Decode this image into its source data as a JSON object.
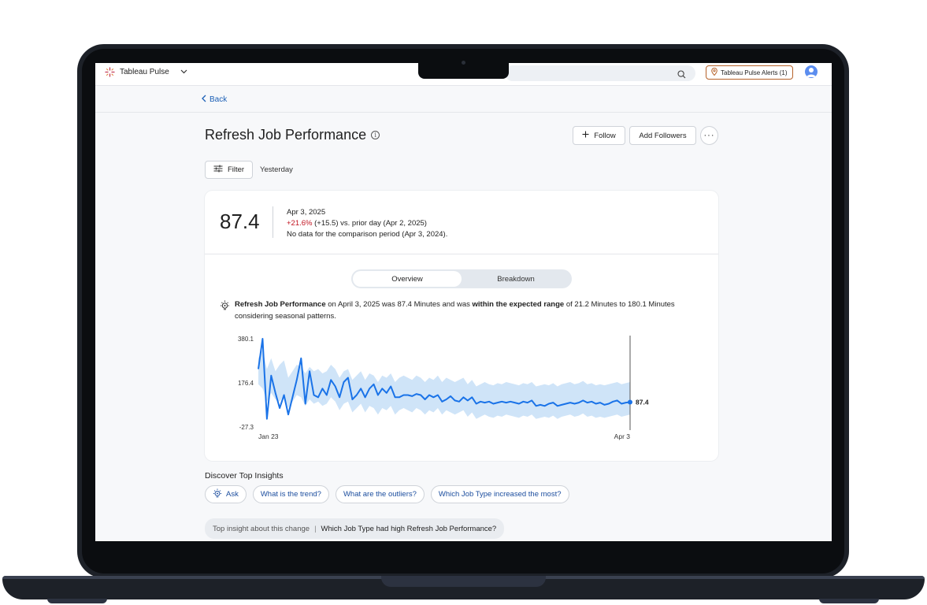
{
  "app": {
    "name": "Tableau Pulse",
    "alerts_label": "Tableau Pulse Alerts (1)"
  },
  "nav": {
    "back_label": "Back"
  },
  "page": {
    "title": "Refresh Job Performance",
    "follow_label": "Follow",
    "add_followers_label": "Add Followers",
    "more_label": "···"
  },
  "filter": {
    "label": "Filter",
    "value": "Yesterday"
  },
  "kpi": {
    "value": "87.4",
    "date": "Apr 3, 2025",
    "change_pct": "+21.6%",
    "change_detail": "(+15.5) vs. prior day (Apr 2, 2025)",
    "comparison_note": "No data for the comparison period (Apr 3, 2024)."
  },
  "tabs": [
    {
      "label": "Overview",
      "active": true
    },
    {
      "label": "Breakdown",
      "active": false
    }
  ],
  "insight": {
    "metric": "Refresh Job Performance",
    "mid1": "on April 3, 2025 was 87.4 Minutes and was",
    "emphasis": "within the expected range",
    "mid2": "of 21.2 Minutes to 180.1 Minutes considering seasonal patterns."
  },
  "chart_data": {
    "type": "line",
    "x_start_label": "Jan 23",
    "x_end_label": "Apr 3",
    "y_ticks": [
      "380.1",
      "176.4",
      "-27.3"
    ],
    "ylim": [
      -27.3,
      380.1
    ],
    "last_value_label": "87.4",
    "series": [
      {
        "values": [
          240,
          380,
          10,
          210,
          130,
          60,
          120,
          30,
          110,
          190,
          290,
          80,
          230,
          120,
          110,
          150,
          120,
          190,
          160,
          110,
          180,
          200,
          100,
          120,
          150,
          110,
          150,
          170,
          120,
          150,
          130,
          160,
          110,
          110,
          120,
          120,
          115,
          125,
          120,
          100,
          120,
          110,
          120,
          90,
          100,
          115,
          95,
          90,
          110,
          95,
          110,
          80,
          90,
          85,
          90,
          80,
          85,
          90,
          85,
          90,
          85,
          80,
          90,
          85,
          95,
          70,
          75,
          70,
          80,
          85,
          70,
          75,
          80,
          85,
          80,
          85,
          95,
          85,
          90,
          80,
          85,
          75,
          80,
          90,
          95,
          80,
          85,
          87.4
        ]
      }
    ],
    "band_upper": [
      290,
      330,
      240,
      290,
      230,
      260,
      280,
      200,
      230,
      260,
      250,
      220,
      250,
      230,
      240,
      220,
      230,
      260,
      240,
      200,
      230,
      240,
      190,
      210,
      230,
      190,
      220,
      210,
      180,
      210,
      200,
      220,
      180,
      200,
      210,
      200,
      190,
      210,
      200,
      180,
      200,
      190,
      210,
      180,
      200,
      190,
      180,
      190,
      200,
      170,
      190,
      160,
      170,
      180,
      170,
      165,
      175,
      170,
      180,
      175,
      170,
      165,
      175,
      170,
      180,
      160,
      165,
      170,
      165,
      175,
      160,
      170,
      175,
      180,
      170,
      175,
      185,
      170,
      175,
      165,
      170,
      165,
      170,
      175,
      180,
      170,
      175,
      180
    ],
    "band_lower": [
      170,
      150,
      90,
      130,
      100,
      90,
      120,
      60,
      90,
      120,
      110,
      70,
      100,
      80,
      90,
      70,
      80,
      110,
      90,
      50,
      80,
      90,
      40,
      60,
      80,
      40,
      70,
      60,
      30,
      60,
      50,
      70,
      30,
      50,
      60,
      50,
      40,
      60,
      50,
      30,
      50,
      40,
      60,
      30,
      50,
      40,
      30,
      40,
      50,
      20,
      40,
      10,
      20,
      30,
      20,
      15,
      25,
      20,
      30,
      25,
      20,
      15,
      25,
      20,
      30,
      10,
      15,
      20,
      15,
      25,
      10,
      20,
      25,
      30,
      20,
      25,
      35,
      20,
      25,
      15,
      20,
      15,
      20,
      25,
      30,
      20,
      25,
      30
    ],
    "colors": {
      "line": "#1a73e8",
      "band": "#cfe4f8"
    }
  },
  "discover": {
    "title": "Discover Top Insights",
    "ask_label": "Ask",
    "questions": [
      "What is the trend?",
      "What are the outliers?",
      "Which Job Type increased the most?"
    ]
  },
  "top_insight": {
    "label": "Top insight about this change",
    "separator": "|",
    "question": "Which Job Type had high Refresh Job Performance?"
  }
}
